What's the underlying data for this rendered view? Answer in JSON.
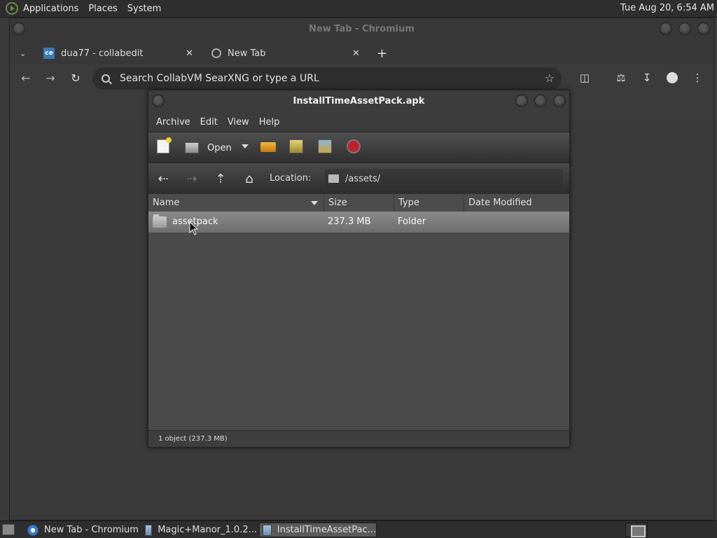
{
  "top_panel": {
    "menus": [
      "Applications",
      "Places",
      "System"
    ],
    "clock": "Tue Aug 20,  6:54 AM"
  },
  "chromium": {
    "window_title": "New Tab - Chromium",
    "tabs": [
      {
        "label": "dua77 - collabedit",
        "icon": "collabedit-icon"
      },
      {
        "label": "New Tab",
        "icon": "globe-icon"
      }
    ],
    "new_tab_symbol": "+",
    "omnibox_placeholder": "Search CollabVM SearXNG or type a URL"
  },
  "archive": {
    "window_title": "InstallTimeAssetPack.apk",
    "menus": [
      "Archive",
      "Edit",
      "View",
      "Help"
    ],
    "toolbar": {
      "open_label": "Open"
    },
    "location_label": "Location:",
    "location_path": "/assets/",
    "columns": [
      "Name",
      "Size",
      "Type",
      "Date Modified"
    ],
    "rows": [
      {
        "name": "assetpack",
        "size": "237.3 MB",
        "type": "Folder",
        "date": ""
      }
    ],
    "status": "1 object (237.3 MB)"
  },
  "taskbar": {
    "tasks": [
      {
        "label": "New Tab - Chromium",
        "icon": "chromium-icon"
      },
      {
        "label": "Magic+Manor_1.0.2...",
        "icon": "archive-icon"
      },
      {
        "label": "InstallTimeAssetPac...",
        "icon": "archive-icon"
      }
    ]
  },
  "colors": {
    "panel": "#2e2e2e",
    "window_bg": "#3b3b3b",
    "selection": "#7c7c7c",
    "stop_red": "#c0202a"
  }
}
